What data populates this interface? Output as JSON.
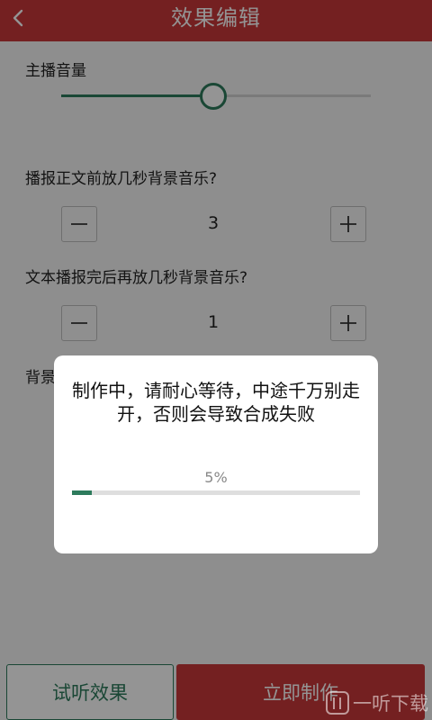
{
  "header": {
    "title": "效果编辑",
    "back_icon": "chevron-left-icon"
  },
  "anchor_volume": {
    "label": "主播音量",
    "level_fraction": 0.49
  },
  "pre_music": {
    "label": "播报正文前放几秒背景音乐?",
    "value": "3"
  },
  "post_music": {
    "label": "文本播报完后再放几秒背景音乐?",
    "value": "1"
  },
  "background_music": {
    "label_partial": "背景"
  },
  "dialog": {
    "message": "制作中，请耐心等待，中途千万别走开，否则会导致合成失败",
    "progress_text": "5%",
    "progress_fraction": 0.07
  },
  "footer": {
    "preview_label": "试听效果",
    "make_label": "立即制作"
  },
  "watermark": {
    "text": "一听下载"
  },
  "colors": {
    "brand_red": "#c9383a",
    "accent_green": "#2d7b5c"
  }
}
